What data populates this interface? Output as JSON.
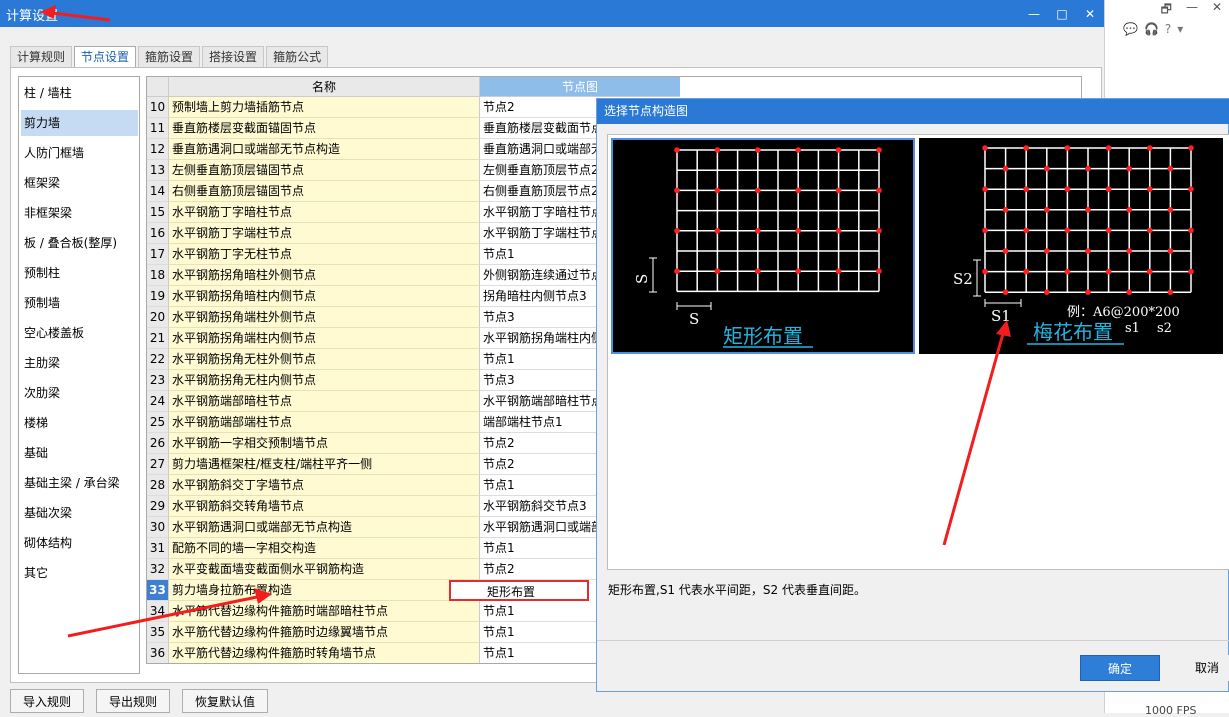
{
  "window": {
    "title": "计算设置",
    "min": "—",
    "max": "□",
    "close": "✕"
  },
  "right_strip": {
    "max": "🗗",
    "min": "—",
    "close": "✕",
    "fps": "1000 FPS"
  },
  "tabs": [
    {
      "label": "计算规则"
    },
    {
      "label": "节点设置"
    },
    {
      "label": "箍筋设置"
    },
    {
      "label": "搭接设置"
    },
    {
      "label": "箍筋公式"
    }
  ],
  "nav": [
    "柱 / 墙柱",
    "剪力墙",
    "人防门框墙",
    "框架梁",
    "非框架梁",
    "板 / 叠合板(整厚)",
    "预制柱",
    "预制墙",
    "空心楼盖板",
    "主肋梁",
    "次肋梁",
    "楼梯",
    "基础",
    "基础主梁 / 承台梁",
    "基础次梁",
    "砌体结构",
    "其它"
  ],
  "grid": {
    "col_name": "名称",
    "col_node": "节点图",
    "rows": [
      {
        "n": "10",
        "name": "预制墙上剪力墙插筋节点",
        "val": "节点2"
      },
      {
        "n": "11",
        "name": "垂直筋楼层变截面锚固节点",
        "val": "垂直筋楼层变截面节点"
      },
      {
        "n": "12",
        "name": "垂直筋遇洞口或端部无节点构造",
        "val": "垂直筋遇洞口或端部无"
      },
      {
        "n": "13",
        "name": "左侧垂直筋顶层锚固节点",
        "val": "左侧垂直筋顶层节点2"
      },
      {
        "n": "14",
        "name": "右侧垂直筋顶层锚固节点",
        "val": "右侧垂直筋顶层节点2"
      },
      {
        "n": "15",
        "name": "水平钢筋丁字暗柱节点",
        "val": "水平钢筋丁字暗柱节点"
      },
      {
        "n": "16",
        "name": "水平钢筋丁字端柱节点",
        "val": "水平钢筋丁字端柱节点"
      },
      {
        "n": "17",
        "name": "水平钢筋丁字无柱节点",
        "val": "节点1"
      },
      {
        "n": "18",
        "name": "水平钢筋拐角暗柱外侧节点",
        "val": "外侧钢筋连续通过节点"
      },
      {
        "n": "19",
        "name": "水平钢筋拐角暗柱内侧节点",
        "val": "拐角暗柱内侧节点3"
      },
      {
        "n": "20",
        "name": "水平钢筋拐角端柱外侧节点",
        "val": "节点3"
      },
      {
        "n": "21",
        "name": "水平钢筋拐角端柱内侧节点",
        "val": "水平钢筋拐角端柱内侧"
      },
      {
        "n": "22",
        "name": "水平钢筋拐角无柱外侧节点",
        "val": "节点1"
      },
      {
        "n": "23",
        "name": "水平钢筋拐角无柱内侧节点",
        "val": "节点3"
      },
      {
        "n": "24",
        "name": "水平钢筋端部暗柱节点",
        "val": "水平钢筋端部暗柱节点"
      },
      {
        "n": "25",
        "name": "水平钢筋端部端柱节点",
        "val": "端部端柱节点1"
      },
      {
        "n": "26",
        "name": "水平钢筋一字相交预制墙节点",
        "val": "节点2"
      },
      {
        "n": "27",
        "name": "剪力墙遇框架柱/框支柱/端柱平齐一侧",
        "val": "节点2"
      },
      {
        "n": "28",
        "name": "水平钢筋斜交丁字墙节点",
        "val": "节点1"
      },
      {
        "n": "29",
        "name": "水平钢筋斜交转角墙节点",
        "val": "水平钢筋斜交节点3"
      },
      {
        "n": "30",
        "name": "水平钢筋遇洞口或端部无节点构造",
        "val": "水平钢筋遇洞口或端部"
      },
      {
        "n": "31",
        "name": "配筋不同的墙一字相交构造",
        "val": "节点1"
      },
      {
        "n": "32",
        "name": "水平变截面墙变截面侧水平钢筋构造",
        "val": "节点2"
      },
      {
        "n": "33",
        "name": "剪力墙身拉筋布置构造",
        "val": "矩形布置"
      },
      {
        "n": "34",
        "name": "水平筋代替边缘构件箍筋时端部暗柱节点",
        "val": "节点1"
      },
      {
        "n": "35",
        "name": "水平筋代替边缘构件箍筋时边缘翼墙节点",
        "val": "节点1"
      },
      {
        "n": "36",
        "name": "水平筋代替边缘构件箍筋时转角墙节点",
        "val": "节点1"
      }
    ]
  },
  "buttons": {
    "import": "导入规则",
    "export": "导出规则",
    "restore": "恢复默认值"
  },
  "dialog": {
    "title": "选择节点构造图",
    "option1": {
      "caption": "矩形布置",
      "s_h": "S",
      "s_v": "S"
    },
    "option2": {
      "caption": "梅花布置",
      "s1": "S1",
      "s2": "S2",
      "example": "例：A6@200*200",
      "l1": "s1",
      "l2": "s2"
    },
    "description": "矩形布置,S1 代表水平间距，S2 代表垂直间距。",
    "ok": "确定",
    "cancel": "取消"
  },
  "colors": {
    "titlebar": "#2b79d6",
    "accent": "#2e7ed8",
    "highlight": "#e52b2b",
    "name_bg": "#fffad2",
    "dot": "#ff2020",
    "caption": "#23b5e0"
  }
}
